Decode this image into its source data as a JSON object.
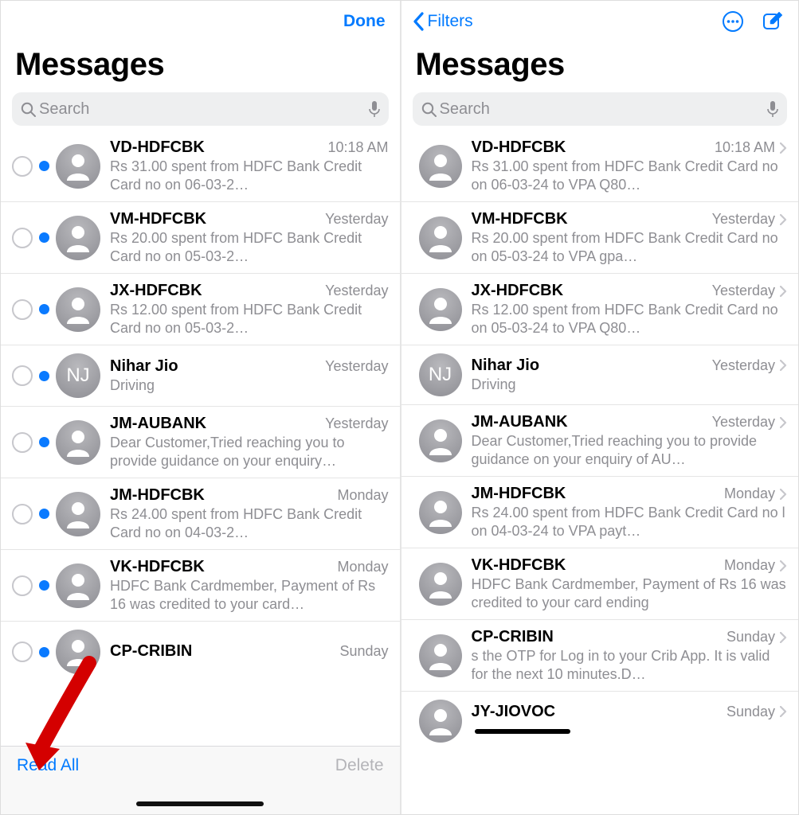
{
  "left": {
    "nav": {
      "done": "Done"
    },
    "title": "Messages",
    "search_placeholder": "Search",
    "bottom": {
      "read_all": "Read All",
      "delete": "Delete"
    },
    "threads": [
      {
        "sender": "VD-HDFCBK",
        "time": "10:18 AM",
        "preview": "Rs 31.00 spent from HDFC Bank Credit Card no           on 06-03-2…",
        "unread": true,
        "initials": ""
      },
      {
        "sender": "VM-HDFCBK",
        "time": "Yesterday",
        "preview": "Rs 20.00 spent from HDFC Bank Credit Card no           on 05-03-2…",
        "unread": true,
        "initials": ""
      },
      {
        "sender": "JX-HDFCBK",
        "time": "Yesterday",
        "preview": "Rs 12.00 spent from HDFC Bank Credit Card no           on 05-03-2…",
        "unread": true,
        "initials": ""
      },
      {
        "sender": "Nihar Jio",
        "time": "Yesterday",
        "preview": "Driving",
        "unread": true,
        "initials": "NJ"
      },
      {
        "sender": "JM-AUBANK",
        "time": "Yesterday",
        "preview": "Dear Customer,Tried reaching you to provide guidance on your enquiry…",
        "unread": true,
        "initials": ""
      },
      {
        "sender": "JM-HDFCBK",
        "time": "Monday",
        "preview": "Rs 24.00 spent from HDFC Bank Credit Card no           on 04-03-2…",
        "unread": true,
        "initials": ""
      },
      {
        "sender": "VK-HDFCBK",
        "time": "Monday",
        "preview": "HDFC Bank Cardmember, Payment of Rs 16 was credited to your card…",
        "unread": true,
        "initials": ""
      },
      {
        "sender": "CP-CRIBIN",
        "time": "Sunday",
        "preview": "",
        "unread": true,
        "initials": ""
      }
    ]
  },
  "right": {
    "nav": {
      "back": "Filters"
    },
    "title": "Messages",
    "search_placeholder": "Search",
    "threads": [
      {
        "sender": "VD-HDFCBK",
        "time": "10:18 AM",
        "preview": "Rs 31.00 spent from HDFC Bank Credit Card no          on 06-03-24 to VPA Q80…",
        "initials": ""
      },
      {
        "sender": "VM-HDFCBK",
        "time": "Yesterday",
        "preview": "Rs 20.00 spent from HDFC Bank Credit Card no          on 05-03-24 to VPA gpa…",
        "initials": ""
      },
      {
        "sender": "JX-HDFCBK",
        "time": "Yesterday",
        "preview": "Rs 12.00 spent from HDFC Bank Credit Card no          on 05-03-24 to VPA Q80…",
        "initials": ""
      },
      {
        "sender": "Nihar Jio",
        "time": "Yesterday",
        "preview": "Driving",
        "initials": "NJ"
      },
      {
        "sender": "JM-AUBANK",
        "time": "Yesterday",
        "preview": "Dear Customer,Tried reaching you to provide guidance on your enquiry of AU…",
        "initials": ""
      },
      {
        "sender": "JM-HDFCBK",
        "time": "Monday",
        "preview": "Rs 24.00 spent from HDFC Bank Credit Card no        l on 04-03-24 to VPA payt…",
        "initials": ""
      },
      {
        "sender": "VK-HDFCBK",
        "time": "Monday",
        "preview": "HDFC Bank Cardmember, Payment of Rs 16 was credited to your card ending",
        "initials": ""
      },
      {
        "sender": "CP-CRIBIN",
        "time": "Sunday",
        "preview": "        s the OTP for Log in to your Crib App. It is valid for the next 10 minutes.D…",
        "initials": ""
      },
      {
        "sender": "JY-JIOVOC",
        "time": "Sunday",
        "preview": "",
        "initials": ""
      }
    ]
  }
}
